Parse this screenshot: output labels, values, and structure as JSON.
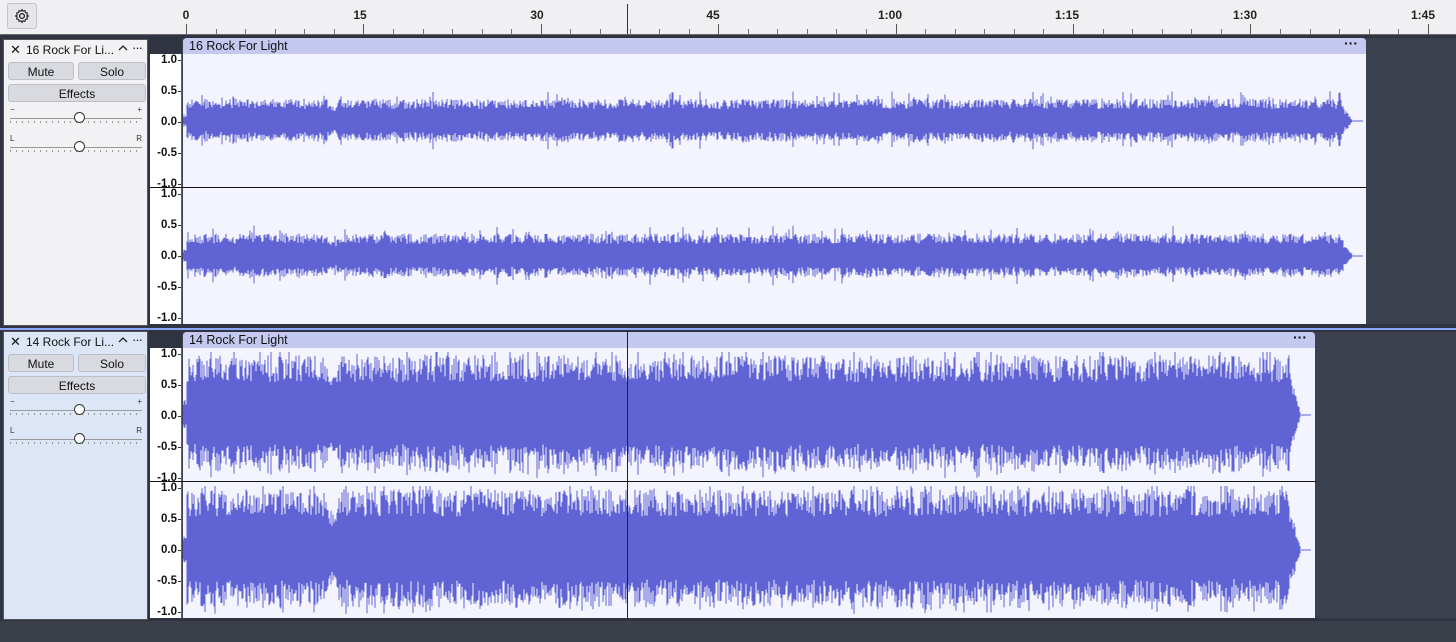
{
  "toolbar": {
    "settings_icon": "gear-icon"
  },
  "ruler": {
    "labels": [
      "0",
      "15",
      "30",
      "45",
      "1:00",
      "1:15",
      "1:30",
      "1:45"
    ]
  },
  "tracks": [
    {
      "name": "16 Rock For Li...",
      "clip_name": "16 Rock For Light",
      "mute_label": "Mute",
      "solo_label": "Solo",
      "effects_label": "Effects",
      "gain_minus": "−",
      "gain_plus": "+",
      "pan_left": "L",
      "pan_right": "R",
      "clip_menu": "···",
      "track_menu": "···",
      "selected": false,
      "amplitude": 0.35
    },
    {
      "name": "14 Rock For Li...",
      "clip_name": "14 Rock For Light",
      "mute_label": "Mute",
      "solo_label": "Solo",
      "effects_label": "Effects",
      "gain_minus": "−",
      "gain_plus": "+",
      "pan_left": "L",
      "pan_right": "R",
      "clip_menu": "···",
      "track_menu": "···",
      "selected": true,
      "amplitude": 0.95
    }
  ],
  "scale_labels": [
    "1.0",
    "0.5",
    "0.0",
    "-0.5",
    "-1.0"
  ],
  "colors": {
    "waveform": "#6063d3",
    "clip_header": "#c5c9ef",
    "clip_background": "#f4f4ff",
    "selected_track": "#dce6f7"
  }
}
